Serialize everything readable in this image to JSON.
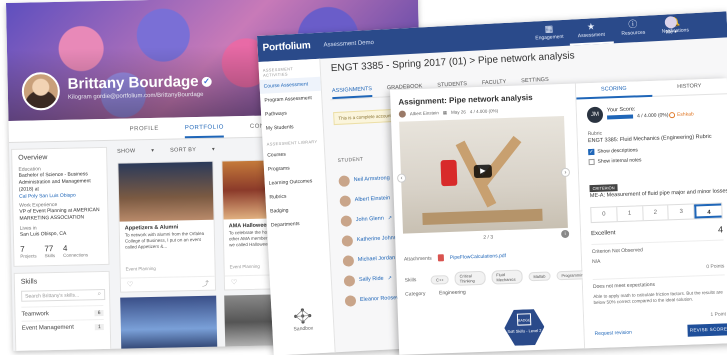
{
  "profile": {
    "name": "Brittany Bourdage",
    "handle": "Kilogram gordie@portfolium.com/BrittanyBourdage",
    "tabs": [
      "PROFILE",
      "PORTFOLIO",
      "CONNECTIONS"
    ],
    "active_tab": "PORTFOLIO",
    "overview": {
      "title": "Overview",
      "education_label": "Education",
      "education_text": "Bachelor of Science - Business Administration and Management (2018) at",
      "education_school": "Cal Poly San Luis Obispo",
      "work_label": "Work Experience",
      "work_text": "VP of Event Planning at AMERICAN MARKETING ASSOCIATION",
      "lives_label": "Lives in",
      "lives_text": "San Luis Obispo, CA",
      "stats": [
        {
          "n": "7",
          "label": "Projects"
        },
        {
          "n": "77",
          "label": "Skills"
        },
        {
          "n": "4",
          "label": "Connections"
        }
      ]
    },
    "skills": {
      "title": "Skills",
      "search_placeholder": "Search Brittany's skills...",
      "items": [
        {
          "name": "Teamwork",
          "count": "6"
        },
        {
          "name": "Event Management",
          "count": "1"
        }
      ]
    },
    "filters": {
      "show": "SHOW",
      "sort": "SORT BY"
    },
    "cards": [
      {
        "title": "Appetizers & Alumni",
        "desc": "To network with alumni from the Orfalea College of Business, I put on an event called Appetizers &...",
        "category": "Event Planning"
      },
      {
        "title": "AMA Halloween Se...",
        "desc": "To celebrate the holiday and to meet other AMA members, we put on an event we called Halloween social...",
        "category": "Event Planning"
      }
    ]
  },
  "assess": {
    "brand": "Portfolium",
    "brand_sub": "Assessment Demo",
    "nav": [
      {
        "label": "Engagement",
        "icon": "▦"
      },
      {
        "label": "Assessment",
        "icon": "★"
      },
      {
        "label": "Resources",
        "icon": "ⓘ"
      },
      {
        "label": "Notifications",
        "icon": "🔔"
      }
    ],
    "user_initials": "Me",
    "user_label": "Me ▾",
    "sidebar": {
      "group1": "ASSESSMENT ACTIVITIES",
      "group2": "ASSESSMENT LIBRARY",
      "items1": [
        "Course Assessment",
        "Program Assessment",
        "Pathways",
        "My Students"
      ],
      "items2": [
        "Courses",
        "Programs",
        "Learning Outcomes",
        "Rubrics",
        "Badging",
        "Departments"
      ],
      "sandbox": "Sandbox"
    },
    "course_title": "ENGT 3385 - Spring 2017 (01)  >  Pipe network analysis",
    "course_tabs": [
      "ASSIGNMENTS",
      "GRADEBOOK",
      "STUDENTS",
      "FACULTY",
      "SETTINGS"
    ],
    "notice": "This is a complete account. Vi...",
    "student_head": "STUDENT",
    "students": [
      "Neil Armstrong",
      "Albert Einstein",
      "John Glenn",
      "Katherine Johnson",
      "Michael Jordan",
      "Sally Ride",
      "Eleanor Roosevelt"
    ]
  },
  "detail": {
    "title": "Assignment: Pipe network analysis",
    "meta_name": "Albert Einstein",
    "meta_date": "May 26",
    "meta_score": "4 / 4.000 (0%)",
    "media_count": "2 / 3",
    "attach_label": "Attachments",
    "attach_file": "PipeFlowCalculations.pdf",
    "skills_label": "Skills",
    "skills": [
      "C++",
      "Critical Thinking",
      "Fluid Mechanics",
      "Matlab",
      "Programming",
      "Research"
    ],
    "category_label": "Category",
    "category": "Engineering",
    "badge_label": "Soft Skills - Level 2",
    "badge_top": "BADGE"
  },
  "scoring": {
    "tabs": [
      "SCORING",
      "HISTORY"
    ],
    "active_tab": "SCORING",
    "avatar": "JM",
    "your_score": "Your Score:",
    "score_value": "4 / 4.000 (0%)",
    "score_fraction": 1.0,
    "status": "Eshkab",
    "rubric_label": "Rubric",
    "rubric_name": "ENGT 3385: Fluid Mechanics (Engineering) Rubric",
    "show_desc": "Show descriptions",
    "show_notes": "Show internal notes",
    "criterion_tag": "CRITERION",
    "criterion_title": "ME-A: Measurement of fluid pipe major and minor losses",
    "levels": [
      "0",
      "1",
      "2",
      "3",
      "4"
    ],
    "selected_level": "4",
    "level_name": "Excellent",
    "level_score": "4",
    "criterion_note": "Criterion Not Observed",
    "na": "N/A",
    "points_0": "0 Points",
    "does_not_meet": "Does not meet expectations",
    "does_not_meet_desc": "Able to apply math to calculate friction factors. But the results are below 50% correct compared to the ideal solution.",
    "points_1": "1 Point",
    "request_link": "Request revision",
    "revise_button": "REVISE SCORE"
  }
}
